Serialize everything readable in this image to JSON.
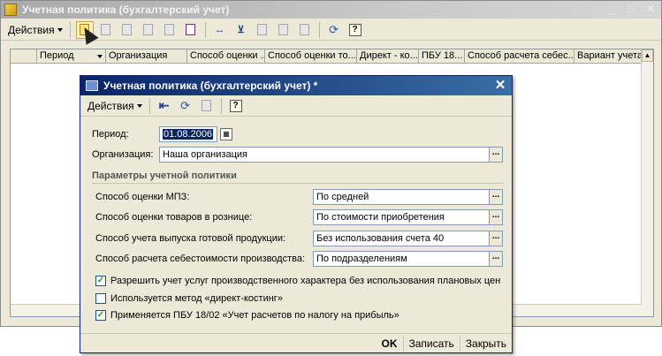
{
  "main_window": {
    "title": "Учетная политика (бухгалтерский учет)",
    "actions_menu": "Действия",
    "window_buttons": [
      "_",
      "□",
      "✕"
    ],
    "columns": [
      "Период",
      "Организация",
      "Способ оценки ...",
      "Способ оценки то...",
      "Директ - ко...",
      "ПБУ 18...",
      "Способ расчета себес...",
      "Вариант учета"
    ]
  },
  "dialog": {
    "title": "Учетная политика (бухгалтерский учет) *",
    "actions_menu": "Действия",
    "period_label": "Период:",
    "period_value": "01.08.2006",
    "org_label": "Организация:",
    "org_value": "Наша организация",
    "group_title": "Параметры учетной политики",
    "params": [
      {
        "label": "Способ оценки МПЗ:",
        "value": "По средней"
      },
      {
        "label": "Способ оценки товаров в рознице:",
        "value": "По стоимости приобретения"
      },
      {
        "label": "Способ учета выпуска готовой продукции:",
        "value": "Без использования счета 40"
      },
      {
        "label": "Способ расчета себестоимости производства:",
        "value": "По подразделениям"
      }
    ],
    "checkboxes": [
      {
        "label": "Разрешить учет услуг производственного характера без использования плановых цен",
        "checked": true
      },
      {
        "label": "Используется метод «директ-костинг»",
        "checked": false
      },
      {
        "label": "Применяется ПБУ 18/02 «Учет расчетов по налогу на прибыль»",
        "checked": true
      }
    ],
    "buttons": {
      "ok": "OK",
      "save": "Записать",
      "close": "Закрыть"
    }
  }
}
